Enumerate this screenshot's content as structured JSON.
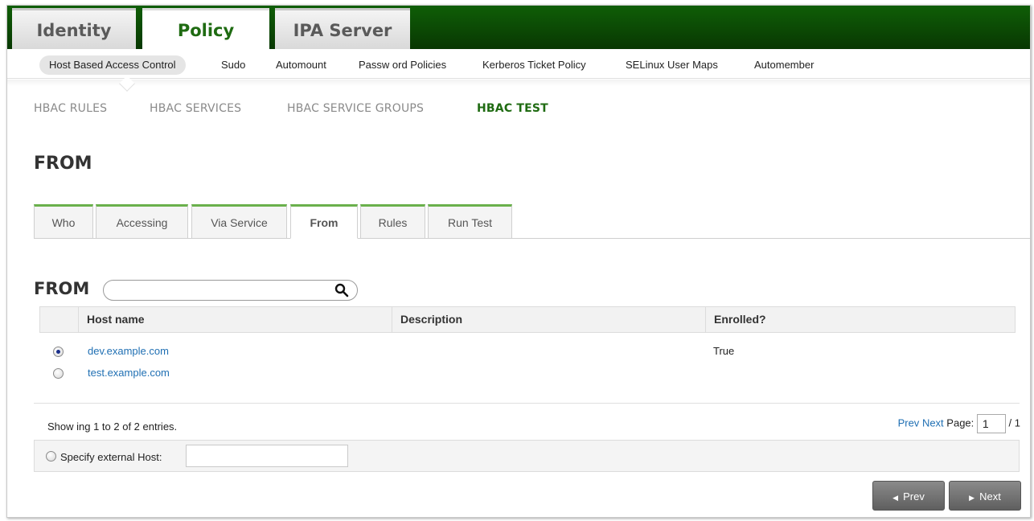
{
  "top_tabs": [
    {
      "label": "Identity"
    },
    {
      "label": "Policy"
    },
    {
      "label": "IPA Server"
    }
  ],
  "submenu": [
    {
      "label": "Host Based Access Control"
    },
    {
      "label": "Sudo"
    },
    {
      "label": "Automount"
    },
    {
      "label": "Passw ord Policies"
    },
    {
      "label": "Kerberos Ticket Policy"
    },
    {
      "label": "SELinux User Maps"
    },
    {
      "label": "Automember"
    }
  ],
  "third_tabs": [
    {
      "label": "HBAC RULES"
    },
    {
      "label": "HBAC SERVICES"
    },
    {
      "label": "HBAC SERVICE GROUPS"
    },
    {
      "label": "HBAC TEST"
    }
  ],
  "section_title": "FROM",
  "steps": [
    {
      "label": "Who"
    },
    {
      "label": "Accessing"
    },
    {
      "label": "Via Service"
    },
    {
      "label": "From"
    },
    {
      "label": "Rules"
    },
    {
      "label": "Run Test"
    }
  ],
  "facet_title": "FROM",
  "search": {
    "placeholder": "",
    "value": ""
  },
  "table": {
    "columns": [
      "Host name",
      "Description",
      "Enrolled?"
    ],
    "rows": [
      {
        "host": "dev.example.com",
        "description": "",
        "enrolled": "True",
        "selected": true
      },
      {
        "host": "test.example.com",
        "description": "",
        "enrolled": "",
        "selected": false
      }
    ]
  },
  "summary": "Show ing 1 to 2 of 2 entries.",
  "pager": {
    "prev": "Prev",
    "next": "Next",
    "page_label": "Page:",
    "page": "1",
    "total": "/ 1"
  },
  "external": {
    "label": "Specify external Host:",
    "value": ""
  },
  "buttons": {
    "prev": "Prev",
    "next": "Next"
  },
  "colors": {
    "accent_green": "#1f6b12",
    "topbar_green": "#0b4704",
    "link_blue": "#1f6fb3"
  },
  "icons": {
    "search": "search-icon",
    "prev": "triangle-left-icon",
    "next": "triangle-right-icon"
  }
}
